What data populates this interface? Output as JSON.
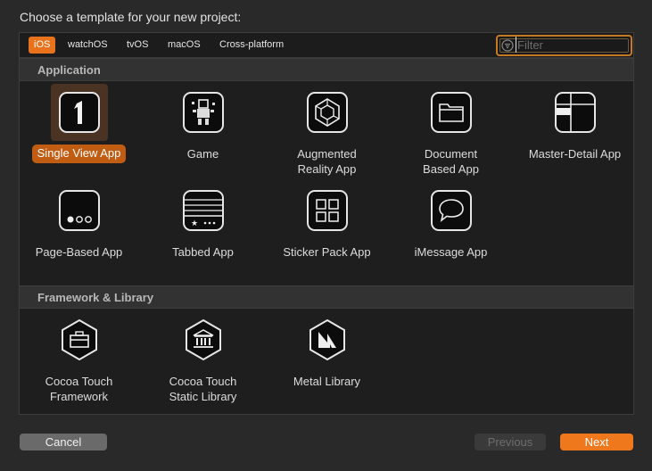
{
  "prompt": "Choose a template for your new project:",
  "platform_tabs": [
    {
      "label": "iOS",
      "active": true
    },
    {
      "label": "watchOS",
      "active": false
    },
    {
      "label": "tvOS",
      "active": false
    },
    {
      "label": "macOS",
      "active": false
    },
    {
      "label": "Cross-platform",
      "active": false
    }
  ],
  "filter": {
    "placeholder": "Filter",
    "value": ""
  },
  "sections": [
    {
      "title": "Application",
      "templates": [
        {
          "label": "Single View App",
          "icon": "single-view-app-icon",
          "selected": true
        },
        {
          "label": "Game",
          "icon": "game-icon",
          "selected": false
        },
        {
          "label": "Augmented\nReality App",
          "icon": "augmented-reality-icon",
          "selected": false
        },
        {
          "label": "Document\nBased App",
          "icon": "document-folder-icon",
          "selected": false
        },
        {
          "label": "Master-Detail App",
          "icon": "master-detail-icon",
          "selected": false
        },
        {
          "label": "Page-Based App",
          "icon": "page-dots-icon",
          "selected": false
        },
        {
          "label": "Tabbed App",
          "icon": "tabbed-app-icon",
          "selected": false
        },
        {
          "label": "Sticker Pack App",
          "icon": "sticker-grid-icon",
          "selected": false
        },
        {
          "label": "iMessage App",
          "icon": "message-bubble-icon",
          "selected": false
        }
      ]
    },
    {
      "title": "Framework & Library",
      "templates": [
        {
          "label": "Cocoa Touch\nFramework",
          "icon": "toolbox-icon",
          "selected": false
        },
        {
          "label": "Cocoa Touch\nStatic Library",
          "icon": "library-building-icon",
          "selected": false
        },
        {
          "label": "Metal Library",
          "icon": "metal-logo-icon",
          "selected": false
        }
      ]
    }
  ],
  "buttons": {
    "cancel": "Cancel",
    "previous": "Previous",
    "next": "Next"
  },
  "colors": {
    "accent": "#e8731c",
    "selected_bg": "#c05d12",
    "next_button": "#f0781c"
  }
}
